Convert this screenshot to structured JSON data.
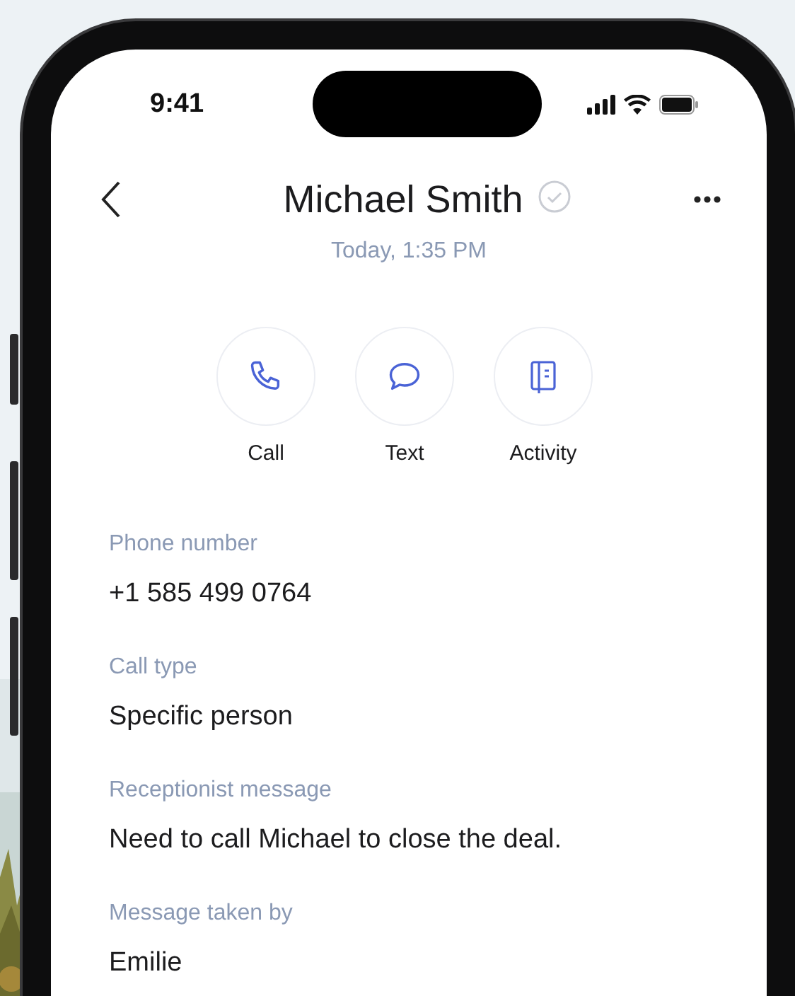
{
  "status_bar": {
    "time": "9:41"
  },
  "header": {
    "title": "Michael Smith",
    "verified": true,
    "subtitle": "Today, 1:35 PM"
  },
  "actions": [
    {
      "kind": "call",
      "label": "Call"
    },
    {
      "kind": "text",
      "label": "Text"
    },
    {
      "kind": "activity",
      "label": "Activity"
    }
  ],
  "fields": [
    {
      "label": "Phone number",
      "value": "+1 585 499 0764"
    },
    {
      "label": "Call type",
      "value": "Specific person"
    },
    {
      "label": "Receptionist message",
      "value": "Need to call Michael to close the deal."
    },
    {
      "label": "Message taken by",
      "value": "Emilie"
    }
  ]
}
